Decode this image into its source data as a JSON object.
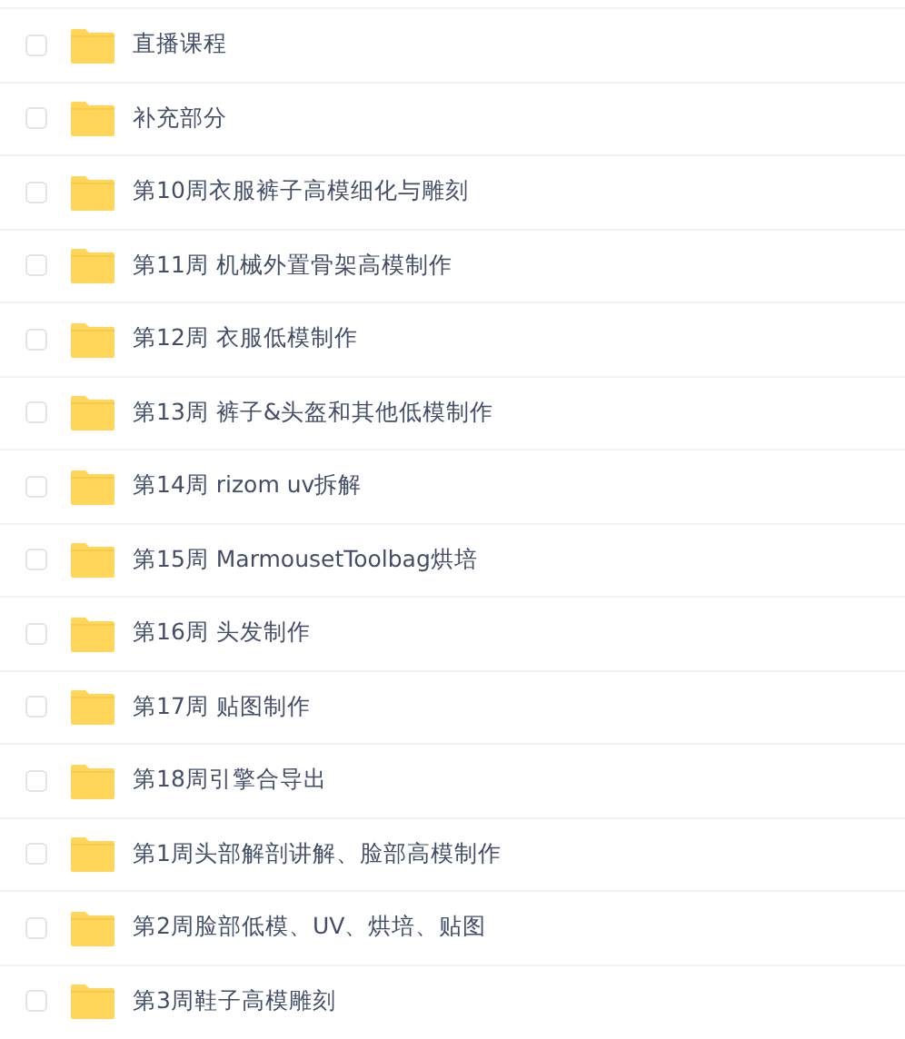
{
  "folders": [
    {
      "name": "直播课程",
      "checked": false
    },
    {
      "name": "补充部分",
      "checked": false
    },
    {
      "name": "第10周衣服裤子高模细化与雕刻",
      "checked": false
    },
    {
      "name": "第11周 机械外置骨架高模制作",
      "checked": false
    },
    {
      "name": "第12周 衣服低模制作",
      "checked": false
    },
    {
      "name": "第13周 裤子&头盔和其他低模制作",
      "checked": false
    },
    {
      "name": "第14周 rizom uv拆解",
      "checked": false
    },
    {
      "name": "第15周 MarmousetToolbag烘培",
      "checked": false
    },
    {
      "name": "第16周 头发制作",
      "checked": false
    },
    {
      "name": "第17周 贴图制作",
      "checked": false
    },
    {
      "name": "第18周引擎合导出",
      "checked": false
    },
    {
      "name": "第1周头部解剖讲解、脸部高模制作",
      "checked": false
    },
    {
      "name": "第2周脸部低模、UV、烘培、贴图",
      "checked": false
    },
    {
      "name": "第3周鞋子高模雕刻",
      "checked": false
    }
  ]
}
